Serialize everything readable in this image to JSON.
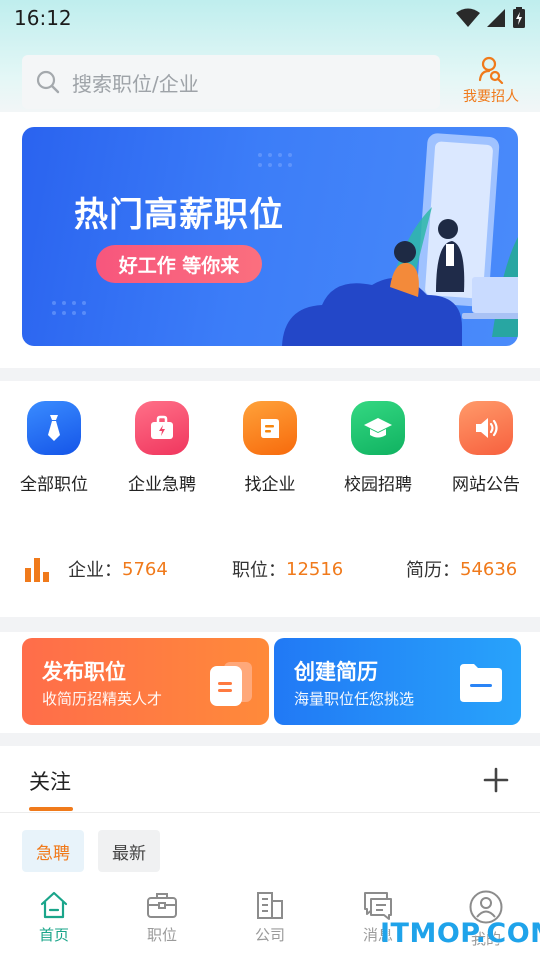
{
  "status_bar": {
    "time": "16:12"
  },
  "search": {
    "placeholder": "搜索职位/企业"
  },
  "recruit": {
    "label": "我要招人"
  },
  "banner": {
    "title": "热门高薪职位",
    "tagline": "好工作 等你来"
  },
  "categories": [
    {
      "label": "全部职位",
      "icon": "tie-icon",
      "color": "#1e6ff5"
    },
    {
      "label": "企业急聘",
      "icon": "urgent-bag-icon",
      "color": "#f5456a"
    },
    {
      "label": "找企业",
      "icon": "company-book-icon",
      "color": "#f97a12"
    },
    {
      "label": "校园招聘",
      "icon": "graduation-cap-icon",
      "color": "#19c06a"
    },
    {
      "label": "网站公告",
      "icon": "speaker-icon",
      "color": "#f96b4a"
    }
  ],
  "stats": {
    "company_label": "企业：",
    "company_value": "5764",
    "job_label": "职位：",
    "job_value": "12516",
    "resume_label": "简历：",
    "resume_value": "54636"
  },
  "actions": {
    "post_job": {
      "title": "发布职位",
      "subtitle": "收简历招精英人才"
    },
    "create_resume": {
      "title": "创建简历",
      "subtitle": "海量职位任您挑选"
    }
  },
  "follow": {
    "title": "关注",
    "chips": [
      "急聘",
      "最新"
    ]
  },
  "nav": [
    {
      "label": "首页",
      "active": true
    },
    {
      "label": "职位",
      "active": false
    },
    {
      "label": "公司",
      "active": false
    },
    {
      "label": "消息",
      "active": false
    },
    {
      "label": "我的",
      "active": false
    }
  ],
  "watermark": "ITMOP.COM",
  "colors": {
    "accent": "#f07a1b",
    "nav_active": "#1aa58a",
    "banner_blue": "#2a63ef"
  }
}
